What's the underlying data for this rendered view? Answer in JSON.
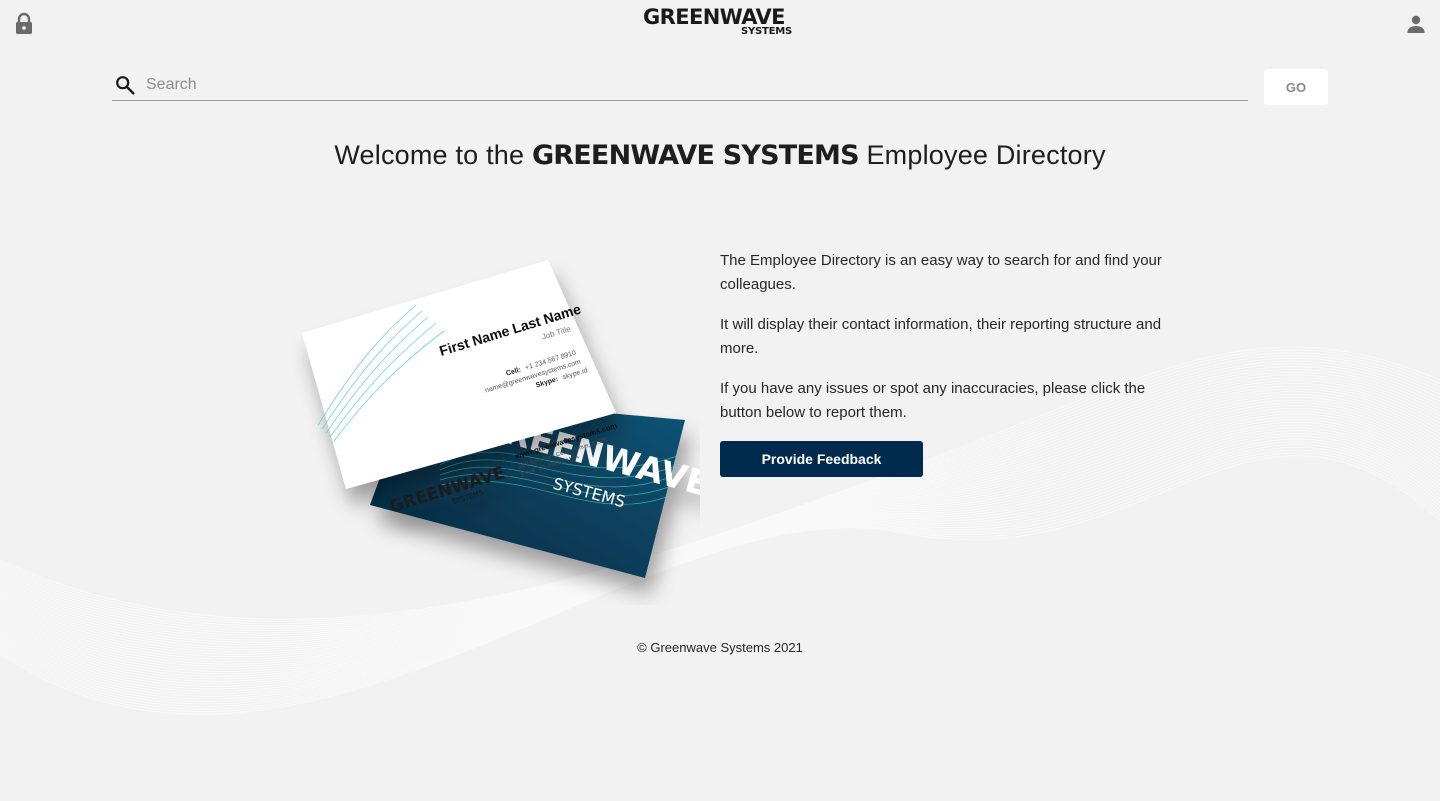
{
  "header": {
    "logo_main": "GREENWAVE",
    "logo_sub": "SYSTEMS",
    "lock_icon": "lock-icon",
    "user_icon": "account-icon"
  },
  "search": {
    "placeholder": "Search",
    "value": "",
    "go_label": "GO",
    "icon": "search-icon"
  },
  "welcome": {
    "prefix": "Welcome to the ",
    "brand": "GREENWAVE SYSTEMS",
    "suffix": " Employee Directory"
  },
  "business_card": {
    "name": "First Name Last Name",
    "job_title": "Job Title",
    "cell_label": "Cell:",
    "cell_value": "+1 234 567 8910",
    "email": "name@greenwavesystems.com",
    "skype_label": "Skype:",
    "skype_value": "skype.id",
    "logo_main": "GREENWAVE",
    "logo_sub": "SYSTEMS",
    "website": "www.greenwavesystems.com",
    "address_line1": "200 Spectrum Center Drive, #1500",
    "address_line2": "Irvine, CA 92618, USA",
    "back_logo_main": "GREENWAVE",
    "back_logo_sub": "SYSTEMS"
  },
  "intro": {
    "p1": "The Employee Directory is an easy way to search for and find your colleagues.",
    "p2": "It will display their contact information, their reporting structure and more.",
    "p3": "If you have any issues or spot any inaccuracies, please click the button below to report them."
  },
  "feedback_label": "Provide Feedback",
  "footer": "© Greenwave Systems 2021",
  "colors": {
    "background": "#f2f2f2",
    "primary": "#002b4f",
    "card_back": "#0a4a6e",
    "accent": "#3fc6b0"
  }
}
